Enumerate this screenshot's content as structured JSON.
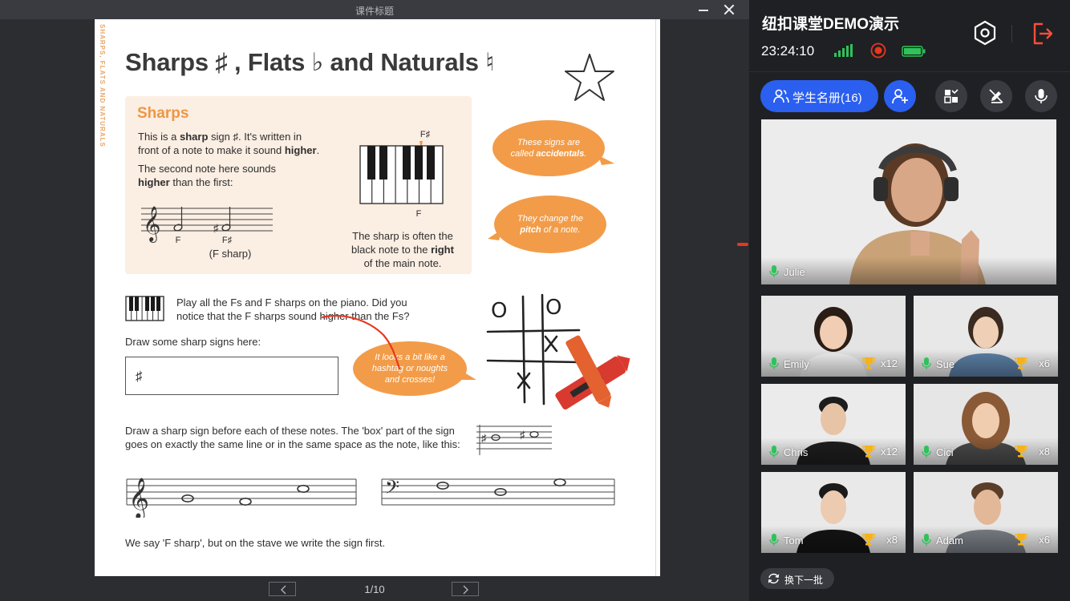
{
  "window": {
    "title": "课件标题"
  },
  "courseware": {
    "spine_text": "SHARPS, FLATS AND NATURALS",
    "page_title": "Sharps ♯ , Flats ♭ and Naturals ♮",
    "sharps": {
      "heading": "Sharps",
      "intro_1a": "This is a ",
      "intro_1b": "sharp",
      "intro_1c": " sign ♯. It's written in",
      "intro_2a": "front of a note to make it sound ",
      "intro_2b": "higher",
      "intro_2c": ".",
      "second_1": "The second note here sounds",
      "second_2a": "higher",
      "second_2b": " than the first:",
      "note_f": "F",
      "note_fsharp": "F♯",
      "note_fsharp_paren": "(F sharp)",
      "key_label_top": "F♯",
      "key_label_bottom": "F",
      "caption_1": "The sharp is often the",
      "caption_2a": "black note to the ",
      "caption_2b": "right",
      "caption_3": "of the main note."
    },
    "bubble_1a": "These signs are",
    "bubble_1b": "called ",
    "bubble_1c": "accidentals",
    "bubble_1d": ".",
    "bubble_2a": "They change the",
    "bubble_2b": "pitch",
    "bubble_2c": " of a note.",
    "play_1": "Play all the Fs and F sharps on the piano. Did you",
    "play_2": "notice that the F sharps sound higher than the Fs?",
    "draw_label": "Draw some sharp signs here:",
    "draw_box_value": "♯",
    "bubble_3a": "It looks a bit like a",
    "bubble_3b": "hashtag or noughts",
    "bubble_3c": "and crosses!",
    "instr_1": "Draw a sharp sign before each of these notes. The 'box' part of the sign",
    "instr_2": "goes on exactly the same line or in the same space as the note, like this:",
    "footer_text": "We say 'F sharp', but on the stave we write the sign first.",
    "tictac": {
      "o": "O",
      "x": "X"
    }
  },
  "pager": {
    "current": "1/10"
  },
  "sidebar": {
    "room_title": "纽扣课堂DEMO演示",
    "time": "23:24:10",
    "roster_label": "学生名册(16)",
    "swap_label": "换下一批",
    "colors": {
      "accent": "#2a5ff0",
      "mic": "#2fc25b",
      "trophy": "#f5b31b",
      "battery": "#2fc25b",
      "rec": "#e8371f",
      "exit": "#ff4d3a"
    },
    "teacher": {
      "name": "Julie"
    },
    "students": [
      {
        "name": "Emily",
        "count": "x12"
      },
      {
        "name": "Sue",
        "count": "x6"
      },
      {
        "name": "Chris",
        "count": "x12"
      },
      {
        "name": "Cici",
        "count": "x8"
      },
      {
        "name": "Tom",
        "count": "x8"
      },
      {
        "name": "Adam",
        "count": "x6"
      }
    ]
  }
}
